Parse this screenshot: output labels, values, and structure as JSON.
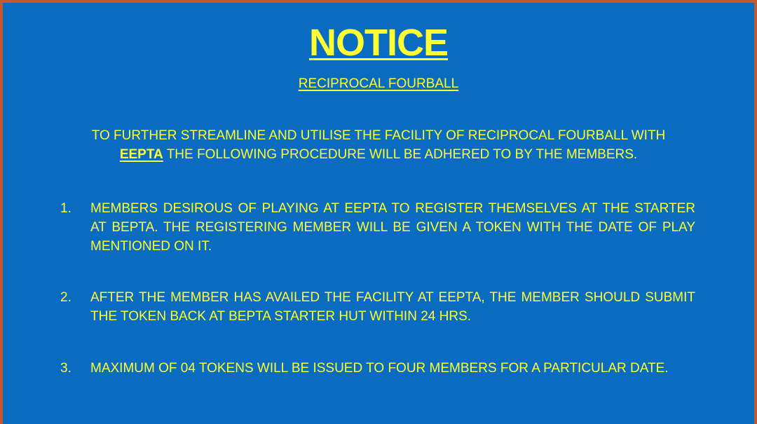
{
  "notice": {
    "title": "NOTICE",
    "subtitle": "RECIPROCAL FOURBALL",
    "intro_part1": "TO FURTHER STREAMLINE AND UTILISE THE FACILITY OF RECIPROCAL FOURBALL WITH",
    "intro_highlight": "EEPTA",
    "intro_part2": " THE FOLLOWING PROCEDURE WILL BE ADHERED TO BY THE MEMBERS.",
    "items": [
      {
        "number": "1.",
        "text": "MEMBERS DESIROUS OF PLAYING AT EEPTA TO REGISTER THEMSELVES AT THE STARTER AT BEPTA. THE REGISTERING MEMBER WILL BE GIVEN A TOKEN WITH THE DATE OF PLAY MENTIONED ON IT."
      },
      {
        "number": "2.",
        "text": "AFTER THE MEMBER HAS AVAILED THE FACILITY AT EEPTA, THE MEMBER SHOULD SUBMIT THE TOKEN BACK AT BEPTA STARTER HUT WITHIN 24 HRS."
      },
      {
        "number": "3.",
        "text": "MAXIMUM OF 04 TOKENS WILL BE ISSUED TO FOUR MEMBERS FOR A PARTICULAR DATE."
      }
    ]
  },
  "colors": {
    "background": "#0a6cc0",
    "text": "#ffff33",
    "border": "#c25a2e"
  }
}
